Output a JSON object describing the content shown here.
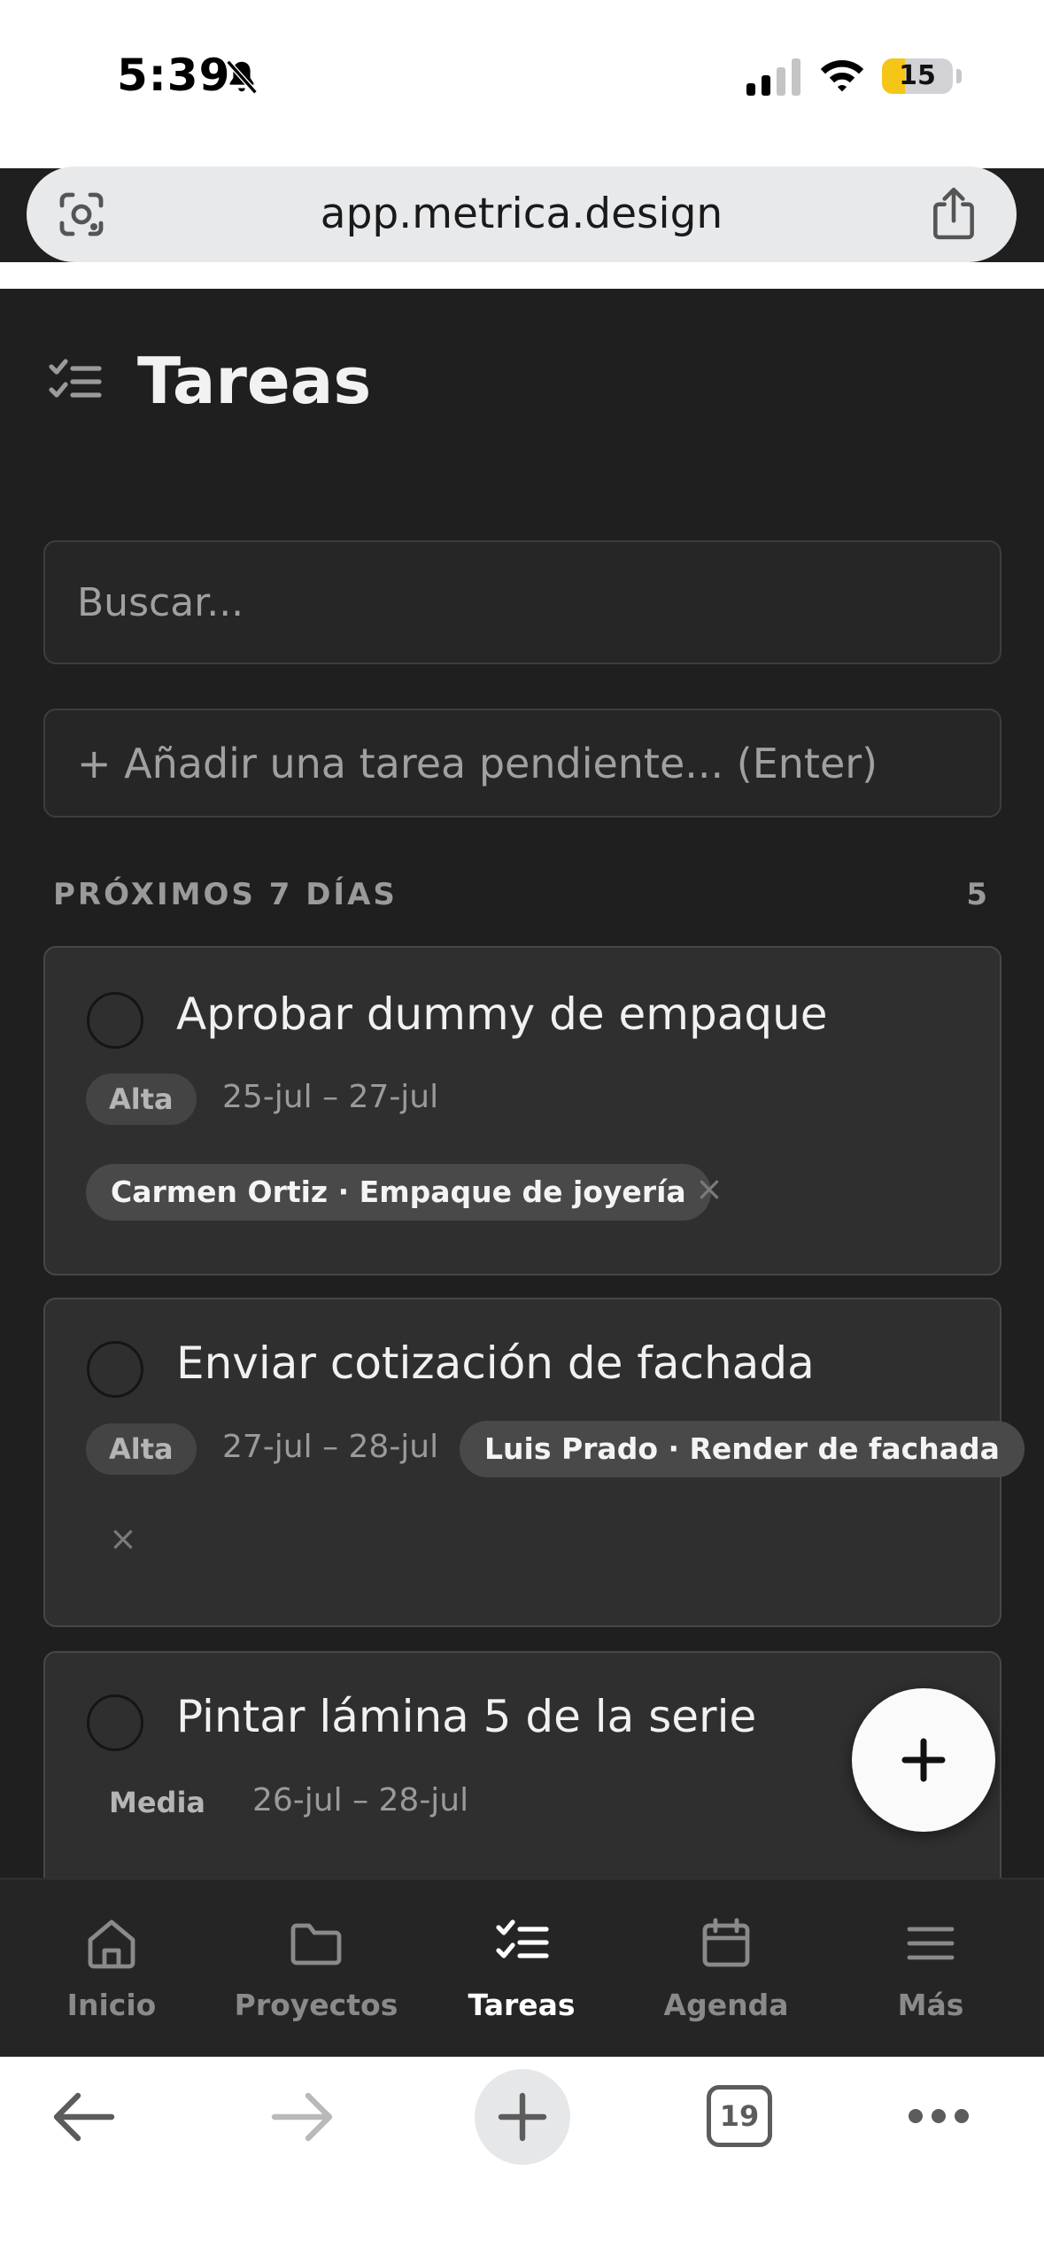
{
  "status_bar": {
    "time": "5:39",
    "battery": "15",
    "battery_level_fraction": 0.15,
    "icons": [
      "bell-slash-icon",
      "cellular-signal-icon",
      "wifi-icon",
      "battery-icon"
    ]
  },
  "browser": {
    "url": "app.metrica.design",
    "tabs_count": "19"
  },
  "header": {
    "title": "Tareas",
    "icon": "task-list-icon"
  },
  "search": {
    "placeholder": "Buscar..."
  },
  "add_task": {
    "placeholder": "+ Añadir una tarea pendiente... (Enter)"
  },
  "section": {
    "title": "PRÓXIMOS 7 DÍAS",
    "count": "5"
  },
  "tasks": [
    {
      "title": "Aprobar dummy de empaque",
      "priority": "Alta",
      "dates": "25-jul – 27-jul",
      "project": "Carmen Ortiz · Empaque de joyería",
      "remove": "×"
    },
    {
      "title": "Enviar cotización de fachada",
      "priority": "Alta",
      "dates": "27-jul – 28-jul",
      "project": "Luis Prado · Render de fachada",
      "remove": "×"
    },
    {
      "title": "Pintar lámina 5 de la serie",
      "priority": "Media",
      "dates": "26-jul – 28-jul"
    }
  ],
  "fab": {
    "icon": "plus-icon"
  },
  "bottom_nav": {
    "items": [
      {
        "label": "Inicio",
        "icon": "home-icon",
        "active": false
      },
      {
        "label": "Proyectos",
        "icon": "folder-icon",
        "active": false
      },
      {
        "label": "Tareas",
        "icon": "task-list-icon",
        "active": true
      },
      {
        "label": "Agenda",
        "icon": "calendar-icon",
        "active": false
      },
      {
        "label": "Más",
        "icon": "menu-icon",
        "active": false
      }
    ]
  },
  "colors": {
    "background": "#1f1f1f",
    "card": "#2f2f2f",
    "text_primary": "#f1f1f1",
    "text_muted": "#9a9a9a",
    "pill": "#494949",
    "fab": "#fafafa"
  }
}
